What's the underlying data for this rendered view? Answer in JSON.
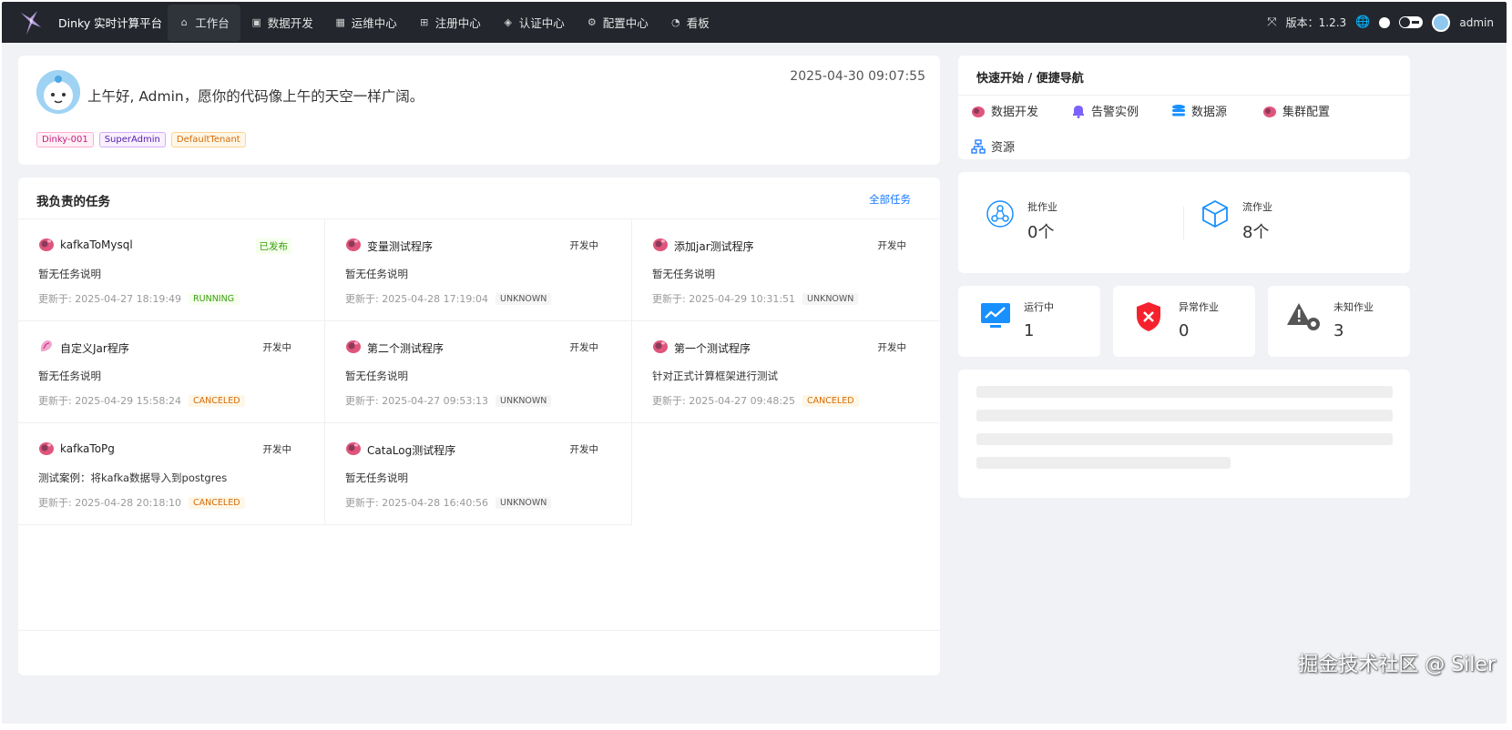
{
  "app": {
    "brand": "Dinky 实时计算平台",
    "version_label": "版本：1.2.3",
    "user": "admin"
  },
  "nav": [
    {
      "label": "工作台",
      "icon": "home-icon",
      "glyph": "⌂",
      "active": true
    },
    {
      "label": "数据开发",
      "icon": "terminal-icon",
      "glyph": "▣"
    },
    {
      "label": "运维中心",
      "icon": "monitor-icon",
      "glyph": "▦"
    },
    {
      "label": "注册中心",
      "icon": "grid-icon",
      "glyph": "⊞"
    },
    {
      "label": "认证中心",
      "icon": "shield-icon",
      "glyph": "◈"
    },
    {
      "label": "配置中心",
      "icon": "gear-icon",
      "glyph": "⚙"
    },
    {
      "label": "看板",
      "icon": "dashboard-icon",
      "glyph": "◔"
    }
  ],
  "greeting": {
    "text": "上午好, Admin，愿你的代码像上午的天空一样广阔。",
    "time": "2025-04-30 09:07:55",
    "tags": [
      "Dinky-001",
      "SuperAdmin",
      "DefaultTenant"
    ]
  },
  "tasks": {
    "title": "我负责的任务",
    "all_link": "全部任务",
    "items": [
      {
        "name": "kafkaToMysql",
        "status": "已发布",
        "desc": "暂无任务说明",
        "updated": "更新于: 2025-04-27 18:19:49",
        "state": "RUNNING"
      },
      {
        "name": "变量测试程序",
        "status": "开发中",
        "desc": "暂无任务说明",
        "updated": "更新于: 2025-04-28 17:19:04",
        "state": "UNKNOWN"
      },
      {
        "name": "添加jar测试程序",
        "status": "开发中",
        "desc": "暂无任务说明",
        "updated": "更新于: 2025-04-29 10:31:51",
        "state": "UNKNOWN"
      },
      {
        "name": "自定义Jar程序",
        "status": "开发中",
        "desc": "暂无任务说明",
        "updated": "更新于: 2025-04-29 15:58:24",
        "state": "CANCELED"
      },
      {
        "name": "第二个测试程序",
        "status": "开发中",
        "desc": "暂无任务说明",
        "updated": "更新于: 2025-04-27 09:53:13",
        "state": "UNKNOWN"
      },
      {
        "name": "第一个测试程序",
        "status": "开发中",
        "desc": "针对正式计算框架进行测试",
        "updated": "更新于: 2025-04-27 09:48:25",
        "state": "CANCELED"
      },
      {
        "name": "kafkaToPg",
        "status": "开发中",
        "desc": "测试案例：将kafka数据导入到postgres",
        "updated": "更新于: 2025-04-28 20:18:10",
        "state": "CANCELED"
      },
      {
        "name": "CataLog测试程序",
        "status": "开发中",
        "desc": "暂无任务说明",
        "updated": "更新于: 2025-04-28 16:40:56",
        "state": "UNKNOWN"
      }
    ]
  },
  "quick": {
    "title": "快速开始 / 便捷导航",
    "items": [
      {
        "label": "数据开发",
        "icon": "flink-icon"
      },
      {
        "label": "告警实例",
        "icon": "bell-icon"
      },
      {
        "label": "数据源",
        "icon": "database-icon"
      },
      {
        "label": "集群配置",
        "icon": "flink-icon"
      },
      {
        "label": "资源",
        "icon": "resource-tree-icon"
      }
    ]
  },
  "stats": {
    "batch_label": "批作业",
    "batch_value": "0个",
    "stream_label": "流作业",
    "stream_value": "8个",
    "running_label": "运行中",
    "running_value": "1",
    "error_label": "异常作业",
    "error_value": "0",
    "unknown_label": "未知作业",
    "unknown_value": "3"
  },
  "watermark": "掘金技术社区 @ Siler",
  "colors": {
    "topbar": "#23272d",
    "link": "#1677ff",
    "running": "#389e0d",
    "canceled": "#d46b08"
  }
}
